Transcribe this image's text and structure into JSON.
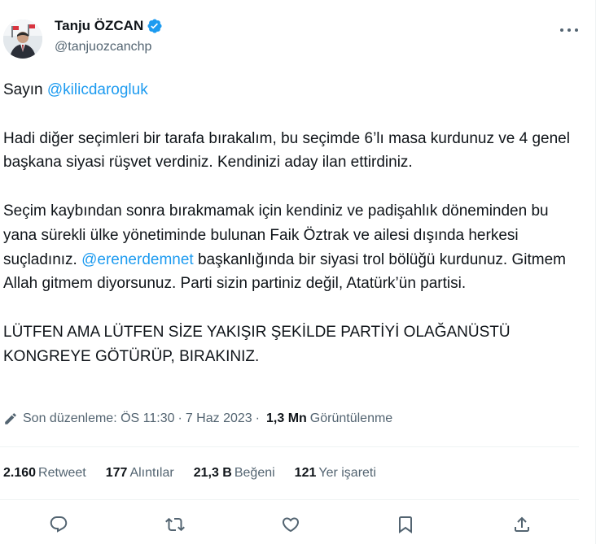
{
  "author": {
    "display_name": "Tanju ÖZCAN",
    "handle": "@tanjuozcanchp",
    "verified": true,
    "avatar_icon": "profile-photo"
  },
  "tweet": {
    "greeting": "Sayın ",
    "greeting_mention": "@kilicdarogluk",
    "p1": "Hadi diğer seçimleri bir tarafa bırakalım,  bu seçimde 6’lı masa kurdunuz ve 4 genel başkana siyasi rüşvet verdiniz. Kendinizi aday ilan ettirdiniz.",
    "p2_before": "Seçim kaybından sonra bırakmamak için kendiniz ve padişahlık döneminden bu yana sürekli ülke yönetiminde bulunan Faik Öztrak ve ailesi dışında herkesi suçladınız. ",
    "p2_mention": "@erenerdemnet",
    "p2_after": " başkanlığında bir siyasi trol bölüğü kurdunuz. Gitmem Allah gitmem diyorsunuz. Parti sizin partiniz değil, Atatürk’ün partisi.",
    "p3": "LÜTFEN AMA LÜTFEN SİZE YAKIŞIR ŞEKİLDE PARTİYİ OLAĞANÜSTÜ KONGREYE GÖTÜRÜP, BIRAKINIZ."
  },
  "meta": {
    "edited_label": "Son düzenleme: ÖS 11:30",
    "separator": "·",
    "date": "7 Haz 2023",
    "views_count": "1,3 Mn",
    "views_label": "Görüntülenme"
  },
  "stats": {
    "retweets_count": "2.160",
    "retweets_label": "Retweet",
    "quotes_count": "177",
    "quotes_label": "Alıntılar",
    "likes_count": "21,3 B",
    "likes_label": "Beğeni",
    "bookmarks_count": "121",
    "bookmarks_label": "Yer işareti"
  },
  "colors": {
    "accent": "#1d9bf0",
    "text_primary": "#0f1419",
    "text_secondary": "#536471",
    "divider": "#eff3f4"
  },
  "action_icons": [
    "reply-icon",
    "retweet-icon",
    "like-icon",
    "bookmark-icon",
    "share-icon"
  ]
}
